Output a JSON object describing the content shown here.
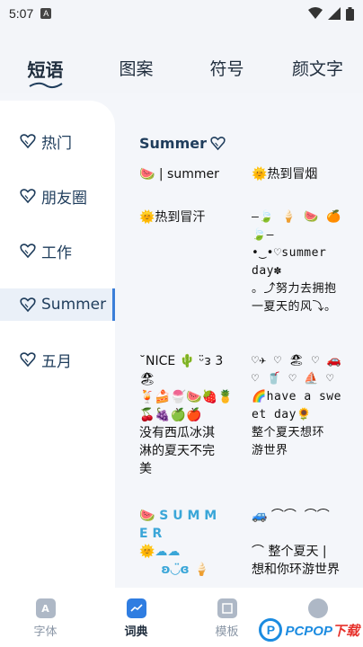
{
  "status_bar": {
    "time": "5:07",
    "badge": "A"
  },
  "top_tabs": [
    {
      "label": "短语",
      "active": true
    },
    {
      "label": "图案",
      "active": false
    },
    {
      "label": "符号",
      "active": false
    },
    {
      "label": "颜文字",
      "active": false
    }
  ],
  "sidebar": {
    "items": [
      {
        "label": "热门",
        "active": false
      },
      {
        "label": "朋友圈",
        "active": false
      },
      {
        "label": "工作",
        "active": false
      },
      {
        "label": "Summer",
        "active": true
      },
      {
        "label": "五月",
        "active": false
      }
    ]
  },
  "content": {
    "section_title": "Summer",
    "cells": [
      "🍉 | summer",
      "🌞热到冒烟",
      "🌞热到冒汗",
      "—🍃 🍦 🍉 🍊\n🍃—\n•‿•♡summer\nday✽\n。⤴努力去拥抱\n一夏天的风⤵。",
      "˘NICE 🌵 ᵕ̈ᴈ 3\n🏖\n🍹🍰🍧🍉🍓🍍\n🍒🍇🍏🍎\n没有西瓜冰淇\n淋的夏天不完\n美",
      "♡✈ ♡ 🏖 ♡ 🚗\n♡ 🥤 ♡ ⛵ ♡\n🌈have a swe\net day🌻\n整个夏天想环\n游世界",
      "🍉 S U M M\nE R\n🌞☁☁\n     ʚ◡̈ɞ 🍦",
      "🚙 ⌒⌒  ⌒⌒\n\n⌒ 整个夏天 |\n想和你环游世界"
    ]
  },
  "bottom_nav": [
    {
      "label": "字体",
      "icon": "font-icon",
      "active": false
    },
    {
      "label": "词典",
      "icon": "dictionary-icon",
      "active": true
    },
    {
      "label": "模板",
      "icon": "template-icon",
      "active": false
    },
    {
      "label": "",
      "icon": "moon-icon",
      "active": false
    }
  ],
  "watermark": {
    "text_blue": "PCPOP",
    "text_red": "下载"
  },
  "colors": {
    "accent": "#3b7ed8",
    "text": "#1f2d3d",
    "inactive": "#8a96a6"
  }
}
